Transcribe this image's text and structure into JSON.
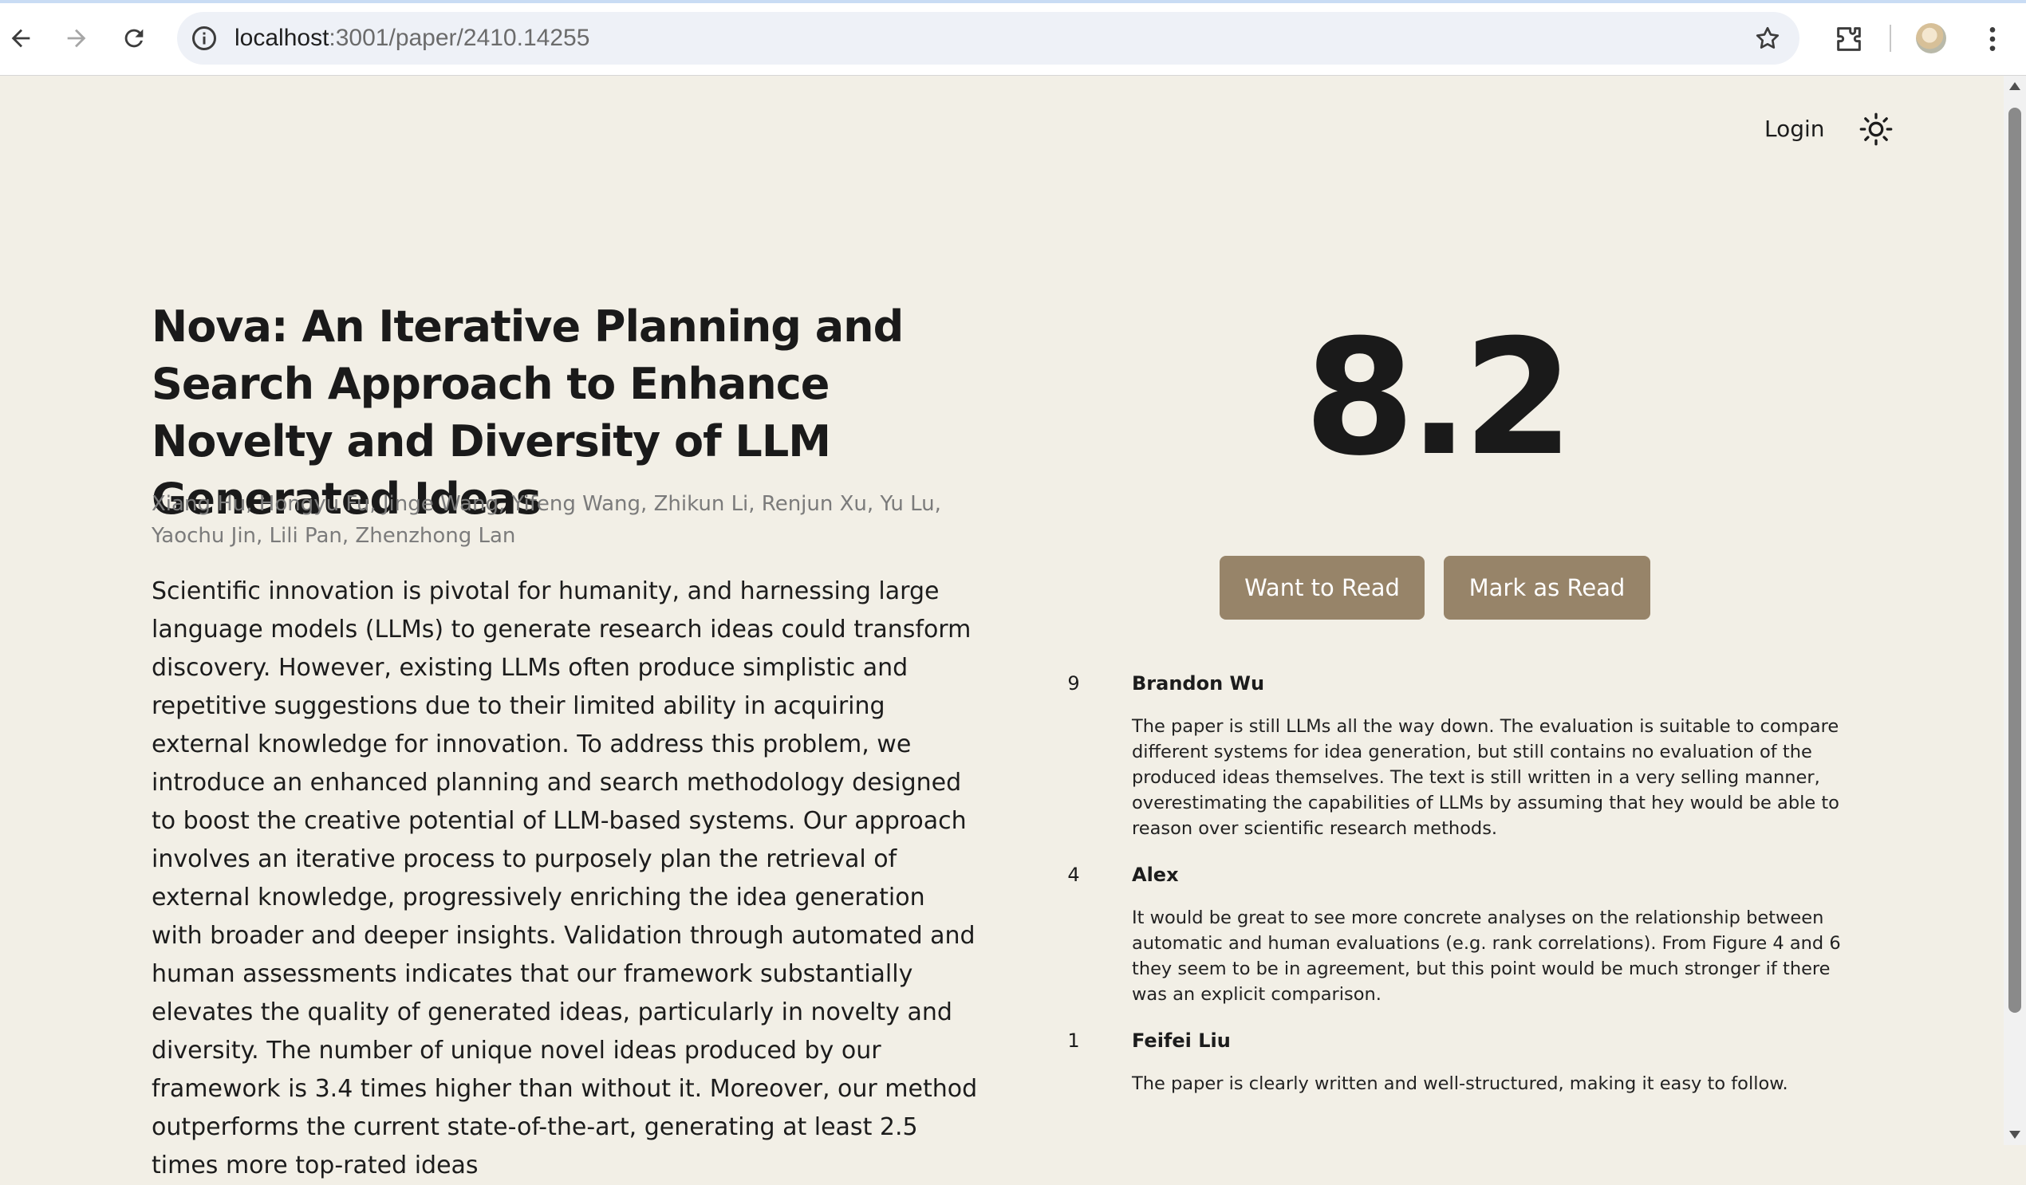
{
  "browser": {
    "url_host": "localhost",
    "url_path": ":3001/paper/2410.14255"
  },
  "header": {
    "login_label": "Login"
  },
  "paper": {
    "title": "Nova: An Iterative Planning and Search Approach to Enhance Novelty and Diversity of LLM Generated Ideas",
    "authors": "Xiang Hu, Hongyu Fu, Jinge Wang, Yifeng Wang, Zhikun Li, Renjun Xu, Yu Lu, Yaochu Jin, Lili Pan, Zhenzhong Lan",
    "abstract": "Scientific innovation is pivotal for humanity, and harnessing large language models (LLMs) to generate research ideas could transform discovery. However, existing LLMs often produce simplistic and repetitive suggestions due to their limited ability in acquiring external knowledge for innovation. To address this problem, we introduce an enhanced planning and search methodology designed to boost the creative potential of LLM-based systems. Our approach involves an iterative process to purposely plan the retrieval of external knowledge, progressively enriching the idea generation with broader and deeper insights. Validation through automated and human assessments indicates that our framework substantially elevates the quality of generated ideas, particularly in novelty and diversity. The number of unique novel ideas produced by our framework is 3.4 times higher than without it. Moreover, our method outperforms the current state-of-the-art, generating at least 2.5 times more top-rated ideas"
  },
  "score": "8.2",
  "actions": {
    "want_to_read": "Want to Read",
    "mark_as_read": "Mark as Read"
  },
  "reviews": [
    {
      "rating": "9",
      "reviewer": "Brandon Wu",
      "comment": "The paper is still LLMs all the way down. The evaluation is suitable to compare different systems for idea generation, but still contains no evaluation of the produced ideas themselves. The text is still written in a very selling manner, overestimating the capabilities of LLMs by assuming that hey would be able to reason over scientific research methods."
    },
    {
      "rating": "4",
      "reviewer": "Alex",
      "comment": "It would be great to see more concrete analyses on the relationship between automatic and human evaluations (e.g. rank correlations). From Figure 4 and 6 they seem to be in agreement, but this point would be much stronger if there was an explicit comparison."
    },
    {
      "rating": "1",
      "reviewer": "Feifei Liu",
      "comment": "The paper is clearly written and well-structured, making it easy to follow."
    }
  ],
  "icons": {
    "back": "arrow-left-icon",
    "forward": "arrow-right-icon",
    "reload": "reload-icon",
    "site_info": "info-icon",
    "bookmark": "star-icon",
    "extensions": "puzzle-icon",
    "menu": "kebab-menu-icon",
    "theme": "sun-icon"
  },
  "colors": {
    "page_background": "#f2efe6",
    "button_background": "#978469",
    "button_text": "#ffffff",
    "text": "#1c1c1c",
    "muted_text": "#7b7b7b"
  }
}
